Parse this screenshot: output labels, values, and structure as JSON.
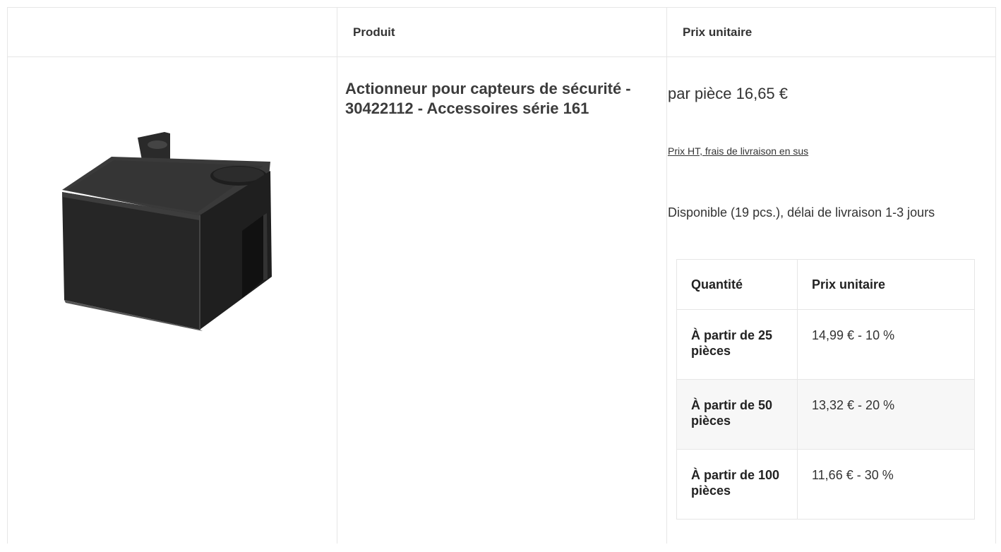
{
  "table": {
    "headers": {
      "image": "",
      "product": "Produit",
      "unit_price": "Prix unitaire"
    }
  },
  "product": {
    "title": "Actionneur pour capteurs de sécurité - 30422112 - Accessoires série 161",
    "image_icon": "black-actuator-block-image"
  },
  "pricing": {
    "main_price": "par pièce 16,65 €",
    "note_link": "Prix HT, frais de livraison en sus ",
    "availability": "Disponible (19 pcs.), délai de livraison 1-3 jours",
    "tiers_headers": {
      "quantity": "Quantité",
      "unit_price": "Prix unitaire"
    },
    "tiers": [
      {
        "quantity": "À partir de 25 pièces",
        "price": "14,99 € - 10 %"
      },
      {
        "quantity": "À partir de 50 pièces",
        "price": "13,32 € - 20 %"
      },
      {
        "quantity": "À partir de 100 pièces",
        "price": "11,66 € - 30 %"
      }
    ]
  },
  "colors": {
    "border": "#e6e6e6",
    "shaded_row": "#f7f7f7",
    "text": "#333333"
  }
}
